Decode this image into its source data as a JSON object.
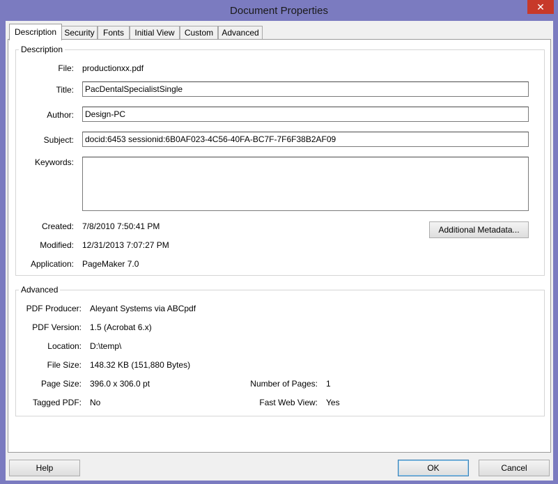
{
  "window": {
    "title": "Document Properties",
    "close_glyph": "✕"
  },
  "tabs": [
    "Description",
    "Security",
    "Fonts",
    "Initial View",
    "Custom",
    "Advanced"
  ],
  "description": {
    "group_title": "Description",
    "file_label": "File:",
    "file_value": "productionxx.pdf",
    "title_label": "Title:",
    "title_value": "PacDentalSpecialistSingle",
    "author_label": "Author:",
    "author_value": "Design-PC",
    "subject_label": "Subject:",
    "subject_value": "docid:6453 sessionid:6B0AF023-4C56-40FA-BC7F-7F6F38B2AF09",
    "keywords_label": "Keywords:",
    "keywords_value": "",
    "created_label": "Created:",
    "created_value": "7/8/2010 7:50:41 PM",
    "modified_label": "Modified:",
    "modified_value": "12/31/2013 7:07:27 PM",
    "application_label": "Application:",
    "application_value": "PageMaker 7.0",
    "metadata_button": "Additional Metadata..."
  },
  "advanced": {
    "group_title": "Advanced",
    "producer_label": "PDF Producer:",
    "producer_value": "Aleyant Systems via ABCpdf",
    "version_label": "PDF Version:",
    "version_value": "1.5 (Acrobat 6.x)",
    "location_label": "Location:",
    "location_value": "D:\\temp\\",
    "filesize_label": "File Size:",
    "filesize_value": "148.32 KB (151,880 Bytes)",
    "pagesize_label": "Page Size:",
    "pagesize_value": "396.0 x 306.0 pt",
    "pages_label": "Number of Pages:",
    "pages_value": "1",
    "tagged_label": "Tagged PDF:",
    "tagged_value": "No",
    "fastweb_label": "Fast Web View:",
    "fastweb_value": "Yes"
  },
  "buttons": {
    "help": "Help",
    "ok": "OK",
    "cancel": "Cancel"
  }
}
